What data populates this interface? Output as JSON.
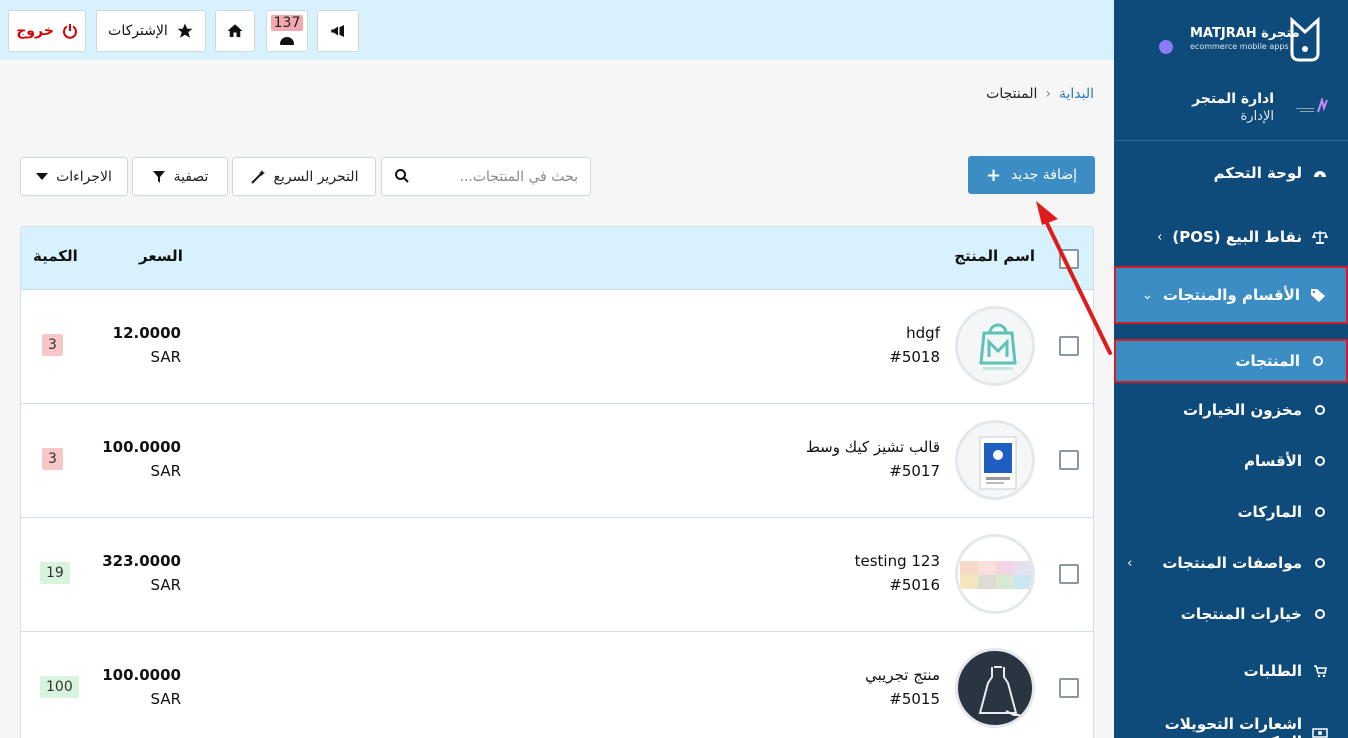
{
  "topbar": {
    "logout_label": "خروج",
    "subscriptions_label": "الإشتركات",
    "notifications_count": "137"
  },
  "breadcrumb": {
    "home": "البداية",
    "current": "المنتجات"
  },
  "toolbar": {
    "add_new_label": "إضافة جديد",
    "search_placeholder": "بحث في المنتجات...",
    "quick_edit_label": "التحرير السريع",
    "filter_label": "تصفية",
    "actions_label": "الاجراءات"
  },
  "table": {
    "headers": {
      "name": "اسم المنتج",
      "price": "السعر",
      "quantity": "الكمية"
    },
    "rows": [
      {
        "name": "hdgf",
        "id": "#5018",
        "price": "12.0000",
        "currency": "SAR",
        "quantity": "3",
        "stock_status": "low"
      },
      {
        "name": "قالب تشيز كيك وسط",
        "id": "#5017",
        "price": "100.0000",
        "currency": "SAR",
        "quantity": "3",
        "stock_status": "low"
      },
      {
        "name": "testing 123",
        "id": "#5016",
        "price": "323.0000",
        "currency": "SAR",
        "quantity": "19",
        "stock_status": "ok"
      },
      {
        "name": "منتج تجريبي",
        "id": "#5015",
        "price": "100.0000",
        "currency": "SAR",
        "quantity": "100",
        "stock_status": "ok"
      }
    ]
  },
  "sidebar": {
    "logo_text": "MATJRAH متجرة",
    "logo_sub": "ecommerce mobile apps",
    "store_title": "ادارة المتجر",
    "store_subtitle": "الإدارة",
    "items": [
      {
        "label": "لوحة التحكم",
        "icon": "dashboard-icon"
      },
      {
        "label": "نقاط البيع (POS)",
        "icon": "scale-icon"
      },
      {
        "label": "الأقسام والمنتجات",
        "icon": "tag-icon",
        "active": true
      },
      {
        "label": "المنتجات",
        "icon": "circle-icon",
        "active": true
      },
      {
        "label": "مخزون الخيارات",
        "icon": "circle-icon"
      },
      {
        "label": "الأقسام",
        "icon": "circle-icon"
      },
      {
        "label": "الماركات",
        "icon": "circle-icon"
      },
      {
        "label": "مواصفات المنتجات",
        "icon": "circle-icon"
      },
      {
        "label": "خيارات المنتجات",
        "icon": "circle-icon"
      },
      {
        "label": "الطلبات",
        "icon": "cart-icon"
      },
      {
        "label": "اشعارات التحويلات البنكية",
        "icon": "money-icon"
      }
    ]
  },
  "colors": {
    "sidebar_bg": "#0e4a7a",
    "accent": "#3b8dc4",
    "header_bg": "#d8f2fd",
    "logout_red": "#d60000",
    "highlight_border": "#d01f2a"
  }
}
